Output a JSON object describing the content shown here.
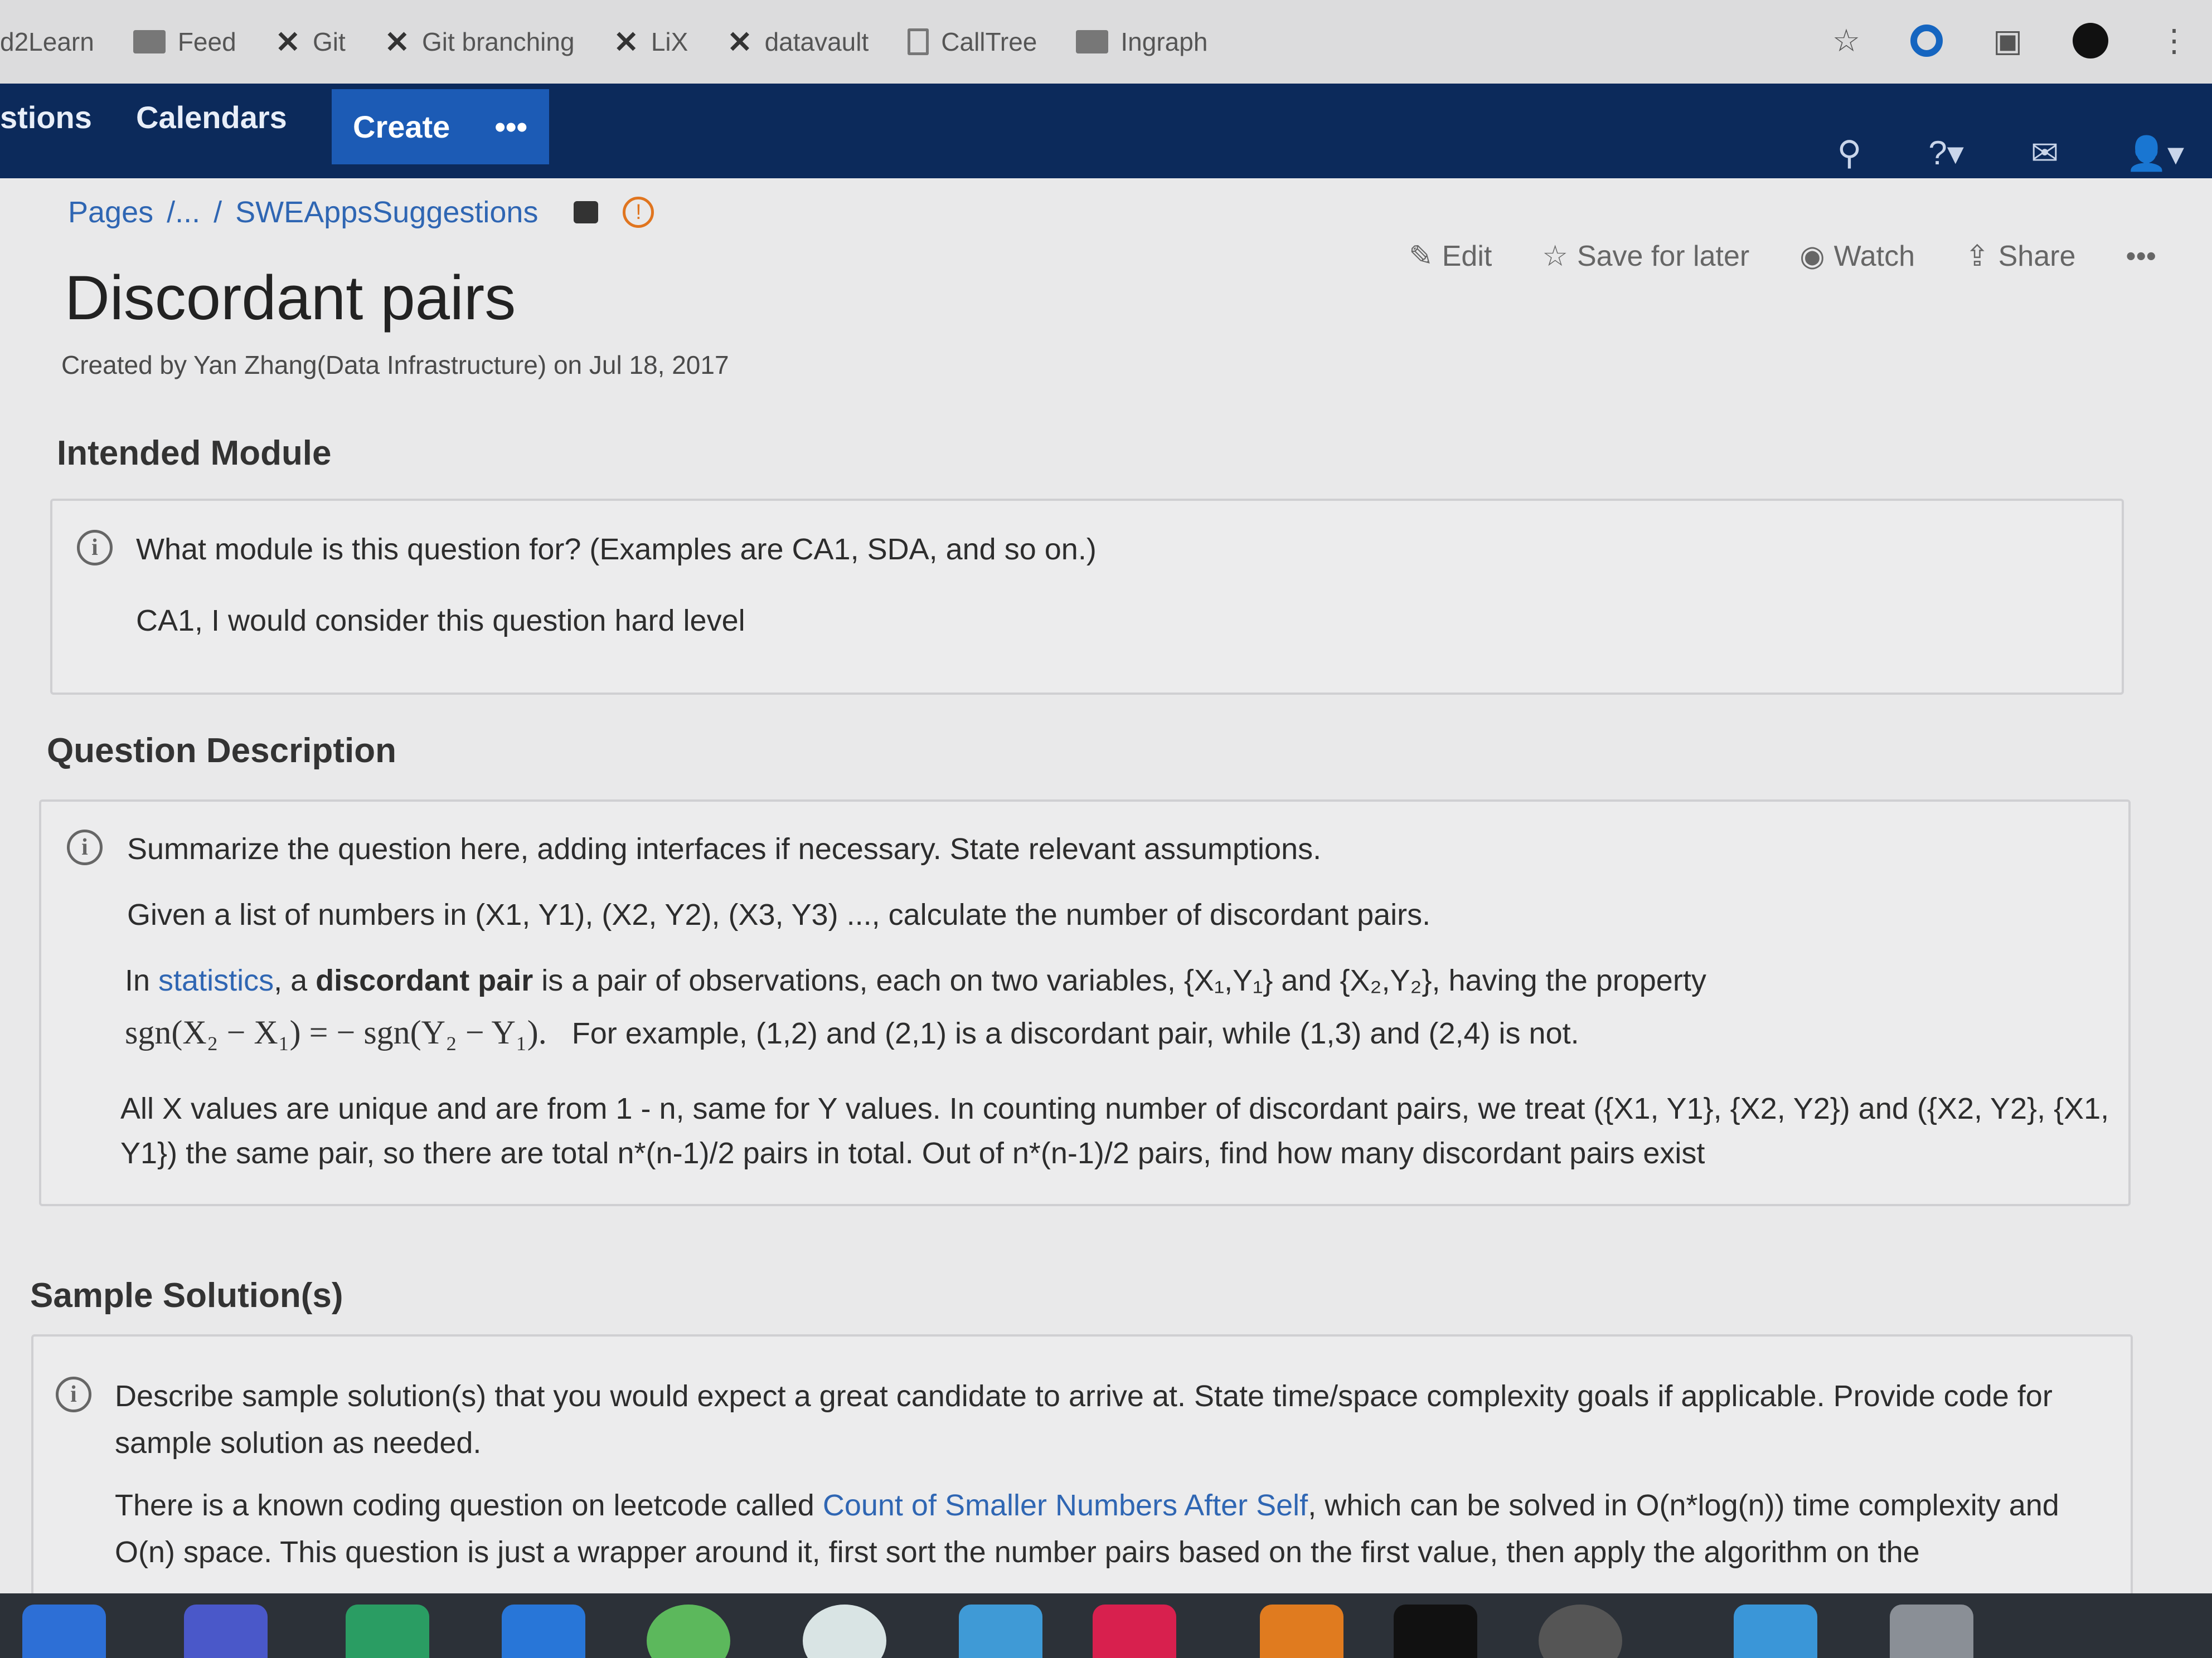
{
  "bookmarks": [
    {
      "label": "d2Learn",
      "icon": "none"
    },
    {
      "label": "Feed",
      "icon": "folder-icon"
    },
    {
      "label": "Git",
      "icon": "x-logo-icon"
    },
    {
      "label": "Git branching",
      "icon": "x-logo-icon"
    },
    {
      "label": "LiX",
      "icon": "x-logo-icon"
    },
    {
      "label": "datavault",
      "icon": "x-logo-icon"
    },
    {
      "label": "CallTree",
      "icon": "document-icon"
    },
    {
      "label": "Ingraph",
      "icon": "folder-icon"
    }
  ],
  "nav": {
    "questions": "stions",
    "calendars": "Calendars",
    "create": "Create",
    "more": "•••"
  },
  "breadcrumb": {
    "root": "Pages",
    "sep1": "/...",
    "sep2": "/",
    "current": "SWEAppsSuggestions",
    "warn": "!"
  },
  "page": {
    "title": "Discordant pairs",
    "byline": "Created by Yan Zhang(Data Infrastructure) on Jul 18, 2017"
  },
  "actions": {
    "edit": "Edit",
    "save": "Save for later",
    "watch": "Watch",
    "share": "Share",
    "more": "•••"
  },
  "intended": {
    "heading": "Intended Module",
    "prompt": "What module is this question for? (Examples are CA1, SDA, and so on.)",
    "answer": "CA1, I would consider this question hard level"
  },
  "description": {
    "heading": "Question Description",
    "prompt": "Summarize the question here, adding interfaces if necessary. State relevant assumptions.",
    "line1": "Given a list of numbers in (X1, Y1), (X2, Y2), (X3, Y3) ..., calculate the number of discordant pairs.",
    "line2_pre": "In ",
    "line2_link": "statistics",
    "line2_mid": ", a ",
    "line2_bold": "discordant pair",
    "line2_post": " is a pair of observations, each on two variables, {X₁,Y₁} and {X₂,Y₂}, having the property",
    "formula": "sgn(X₂ − X₁) = − sgn(Y₂ − Y₁).",
    "line3": "For example, (1,2) and (2,1) is a discordant pair, while (1,3) and (2,4) is not.",
    "line4": "All X values are unique and are from 1 - n, same for Y values. In counting number of discordant pairs, we treat ({X1, Y1}, {X2, Y2}) and ({X2, Y2}, {X1,",
    "line5": "Y1}) the same pair, so there are total n*(n-1)/2 pairs in total. Out of n*(n-1)/2 pairs, find how many discordant pairs exist"
  },
  "solution": {
    "heading": "Sample Solution(s)",
    "prompt1": "Describe sample solution(s) that you would expect a great candidate to arrive at. State time/space complexity goals if applicable. Provide code for",
    "prompt2": "sample solution as needed.",
    "body1_pre": "There is a known coding question on leetcode called ",
    "body1_link": "Count of Smaller Numbers After Self",
    "body1_post": ", which can be solved in O(n*log(n)) time complexity and",
    "body2": "O(n) space. This question is just a wrapper around it, first sort the number pairs based on the first value, then apply the algorithm on the"
  },
  "info_glyph": "i",
  "colors": {
    "nav_bg": "#0c2a5b",
    "create_bg": "#1c5bb5",
    "link": "#2f66b3",
    "warning": "#e0751f"
  }
}
